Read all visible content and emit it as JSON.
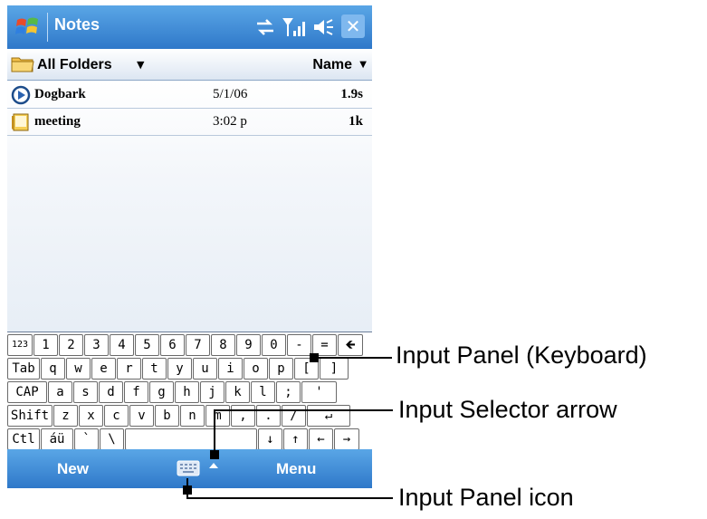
{
  "title_bar": {
    "app_title": "Notes",
    "icons": [
      "windows-start-icon",
      "connectivity-icon",
      "signal-icon",
      "speaker-icon"
    ],
    "close_label": "✕"
  },
  "folder_bar": {
    "folder_label": "All Folders",
    "sort_label": "Name"
  },
  "notes": [
    {
      "name": "Dogbark",
      "date": "5/1/06",
      "size": "1.9s",
      "icon": "voice-note-icon"
    },
    {
      "name": "meeting",
      "date": "3:02 p",
      "size": "1k",
      "icon": "note-document-icon"
    }
  ],
  "keyboard": {
    "rows": [
      [
        "123",
        "1",
        "2",
        "3",
        "4",
        "5",
        "6",
        "7",
        "8",
        "9",
        "0",
        "-",
        "=",
        "🡸"
      ],
      [
        "Tab",
        "q",
        "w",
        "e",
        "r",
        "t",
        "y",
        "u",
        "i",
        "o",
        "p",
        "[",
        "]"
      ],
      [
        "CAP",
        "a",
        "s",
        "d",
        "f",
        "g",
        "h",
        "j",
        "k",
        "l",
        ";",
        "'"
      ],
      [
        "Shift",
        "z",
        "x",
        "c",
        "v",
        "b",
        "n",
        "m",
        ",",
        ".",
        "/",
        "↵"
      ],
      [
        "Ctl",
        "áü",
        "`",
        "\\",
        "",
        "↓",
        "↑",
        "←",
        "→"
      ]
    ]
  },
  "menu_bar": {
    "left_label": "New",
    "right_label": "Menu"
  },
  "callouts": {
    "keyboard": "Input Panel (Keyboard)",
    "selector": "Input Selector arrow",
    "icon": "Input Panel icon"
  }
}
